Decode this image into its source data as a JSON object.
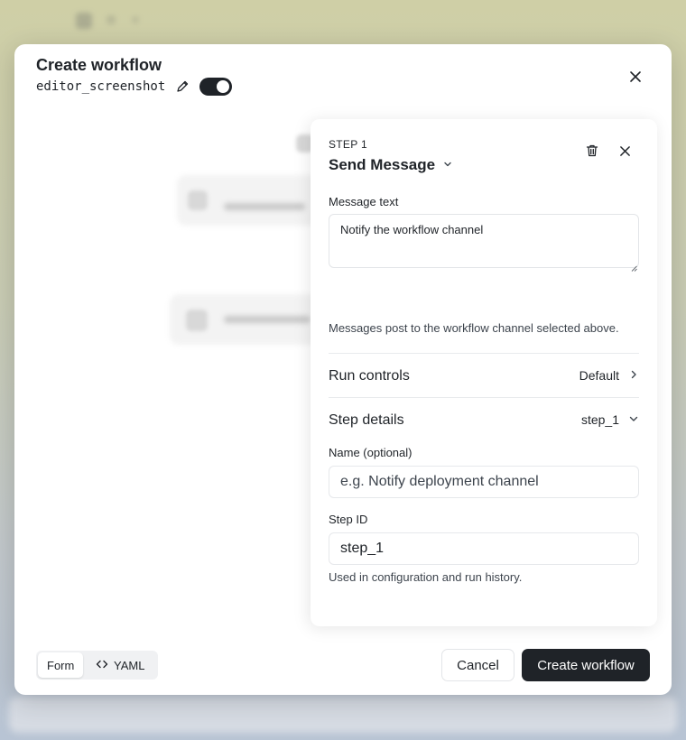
{
  "modal": {
    "title": "Create workflow",
    "workflow_name": "editor_screenshot",
    "enabled": true
  },
  "step_panel": {
    "step_label": "STEP 1",
    "step_type": "Send Message",
    "message_text_label": "Message text",
    "message_text_value": "Notify the workflow channel",
    "message_helper": "Messages post to the workflow channel selected above.",
    "run_controls_label": "Run controls",
    "run_controls_value": "Default",
    "step_details_label": "Step details",
    "step_details_value": "step_1",
    "name_label": "Name (optional)",
    "name_placeholder": "e.g. Notify deployment channel",
    "step_id_label": "Step ID",
    "step_id_value": "step_1",
    "step_id_helper": "Used in configuration and run history."
  },
  "footer": {
    "tab_form": "Form",
    "tab_yaml": "YAML",
    "cancel_label": "Cancel",
    "create_label": "Create workflow"
  },
  "icons": {
    "edit": "pencil-icon",
    "close": "close-icon",
    "delete": "trash-icon",
    "chevron_down": "chevron-down-icon",
    "chevron_right": "chevron-right-icon",
    "code": "code-icon"
  },
  "colors": {
    "primary_button": "#1f2328",
    "toggle_on": "#1f2328"
  }
}
